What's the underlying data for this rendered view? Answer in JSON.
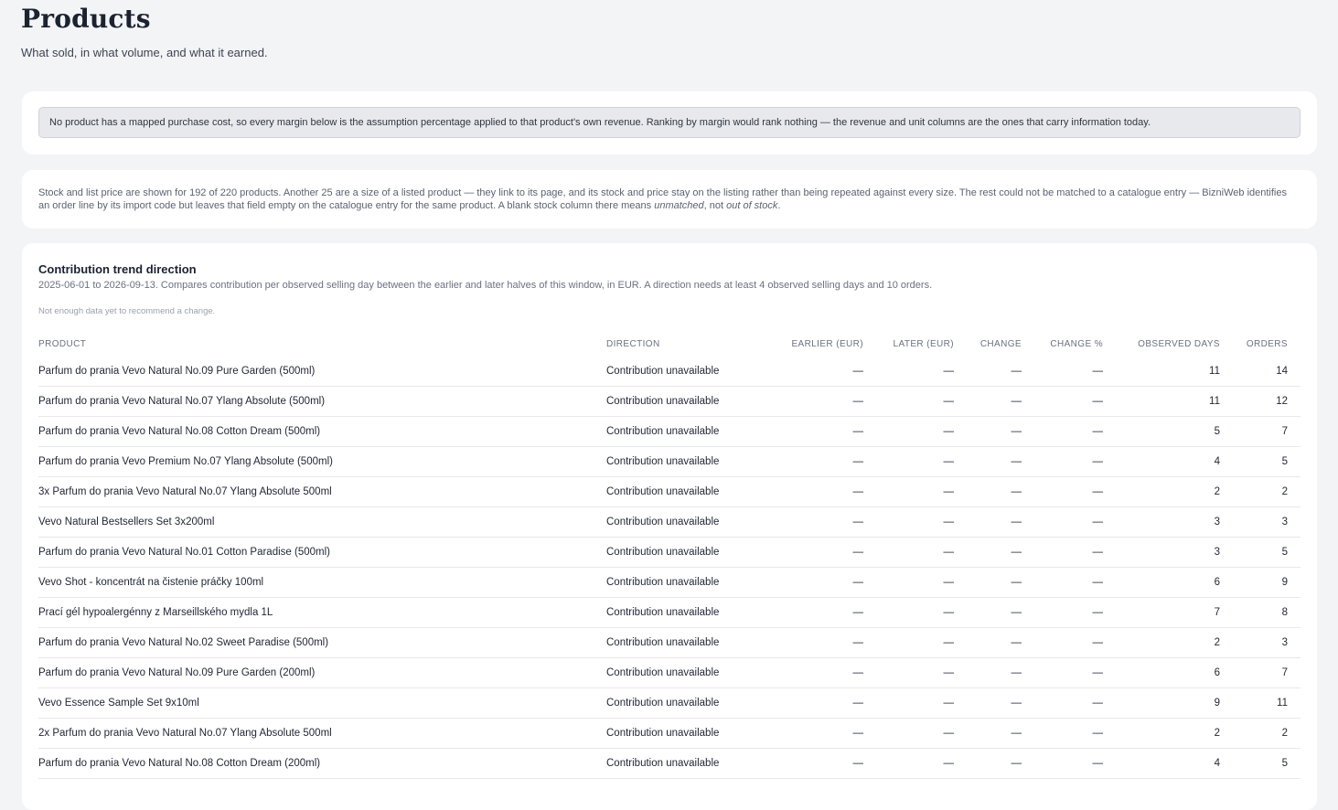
{
  "header": {
    "title": "Products",
    "subtitle": "What sold, in what volume, and what it earned."
  },
  "margin_notice": "No product has a mapped purchase cost, so every margin below is the assumption percentage applied to that product's own revenue. Ranking by margin would rank nothing — the revenue and unit columns are the ones that carry information today.",
  "stock_info": {
    "text": "Stock and list price are shown for 192 of 220 products. Another 25 are a size of a listed product — they link to its page, and its stock and price stay on the listing rather than being repeated against every size. The rest could not be matched to a catalogue entry — BizniWeb identifies an order line by its import code but leaves that field empty on the catalogue entry for the same product. A blank stock column there means ",
    "em1": "unmatched",
    "mid": ", not ",
    "em2": "out of stock",
    "end": "."
  },
  "trend": {
    "title": "Contribution trend direction",
    "description": "2025-06-01 to 2026-09-13. Compares contribution per observed selling day between the earlier and later halves of this window, in EUR. A direction needs at least 4 observed selling days and 10 orders.",
    "note": "Not enough data yet to recommend a change.",
    "columns": {
      "product": "PRODUCT",
      "direction": "DIRECTION",
      "earlier": "EARLIER (EUR)",
      "later": "LATER (EUR)",
      "change": "CHANGE",
      "change_pct": "CHANGE %",
      "observed_days": "OBSERVED DAYS",
      "orders": "ORDERS"
    },
    "rows": [
      {
        "product": "Parfum do prania Vevo Natural No.09 Pure Garden (500ml)",
        "direction": "Contribution unavailable",
        "earlier": "—",
        "later": "—",
        "change": "—",
        "change_pct": "—",
        "days": "11",
        "orders": "14"
      },
      {
        "product": "Parfum do prania Vevo Natural No.07 Ylang Absolute (500ml)",
        "direction": "Contribution unavailable",
        "earlier": "—",
        "later": "—",
        "change": "—",
        "change_pct": "—",
        "days": "11",
        "orders": "12"
      },
      {
        "product": "Parfum do prania Vevo Natural No.08 Cotton Dream (500ml)",
        "direction": "Contribution unavailable",
        "earlier": "—",
        "later": "—",
        "change": "—",
        "change_pct": "—",
        "days": "5",
        "orders": "7"
      },
      {
        "product": "Parfum do prania Vevo Premium No.07 Ylang Absolute (500ml)",
        "direction": "Contribution unavailable",
        "earlier": "—",
        "later": "—",
        "change": "—",
        "change_pct": "—",
        "days": "4",
        "orders": "5"
      },
      {
        "product": "3x Parfum do prania Vevo Natural No.07 Ylang Absolute 500ml",
        "direction": "Contribution unavailable",
        "earlier": "—",
        "later": "—",
        "change": "—",
        "change_pct": "—",
        "days": "2",
        "orders": "2"
      },
      {
        "product": "Vevo Natural Bestsellers Set 3x200ml",
        "direction": "Contribution unavailable",
        "earlier": "—",
        "later": "—",
        "change": "—",
        "change_pct": "—",
        "days": "3",
        "orders": "3"
      },
      {
        "product": "Parfum do prania Vevo Natural No.01 Cotton Paradise (500ml)",
        "direction": "Contribution unavailable",
        "earlier": "—",
        "later": "—",
        "change": "—",
        "change_pct": "—",
        "days": "3",
        "orders": "5"
      },
      {
        "product": "Vevo Shot - koncentrát na čistenie práčky 100ml",
        "direction": "Contribution unavailable",
        "earlier": "—",
        "later": "—",
        "change": "—",
        "change_pct": "—",
        "days": "6",
        "orders": "9"
      },
      {
        "product": "Prací gél hypoalergénny z Marseillského mydla 1L",
        "direction": "Contribution unavailable",
        "earlier": "—",
        "later": "—",
        "change": "—",
        "change_pct": "—",
        "days": "7",
        "orders": "8"
      },
      {
        "product": "Parfum do prania Vevo Natural No.02 Sweet Paradise (500ml)",
        "direction": "Contribution unavailable",
        "earlier": "—",
        "later": "—",
        "change": "—",
        "change_pct": "—",
        "days": "2",
        "orders": "3"
      },
      {
        "product": "Parfum do prania Vevo Natural No.09 Pure Garden (200ml)",
        "direction": "Contribution unavailable",
        "earlier": "—",
        "later": "—",
        "change": "—",
        "change_pct": "—",
        "days": "6",
        "orders": "7"
      },
      {
        "product": "Vevo Essence Sample Set 9x10ml",
        "direction": "Contribution unavailable",
        "earlier": "—",
        "later": "—",
        "change": "—",
        "change_pct": "—",
        "days": "9",
        "orders": "11"
      },
      {
        "product": "2x Parfum do prania Vevo Natural No.07 Ylang Absolute 500ml",
        "direction": "Contribution unavailable",
        "earlier": "—",
        "later": "—",
        "change": "—",
        "change_pct": "—",
        "days": "2",
        "orders": "2"
      },
      {
        "product": "Parfum do prania Vevo Natural No.08 Cotton Dream (200ml)",
        "direction": "Contribution unavailable",
        "earlier": "—",
        "later": "—",
        "change": "—",
        "change_pct": "—",
        "days": "4",
        "orders": "5"
      }
    ]
  }
}
